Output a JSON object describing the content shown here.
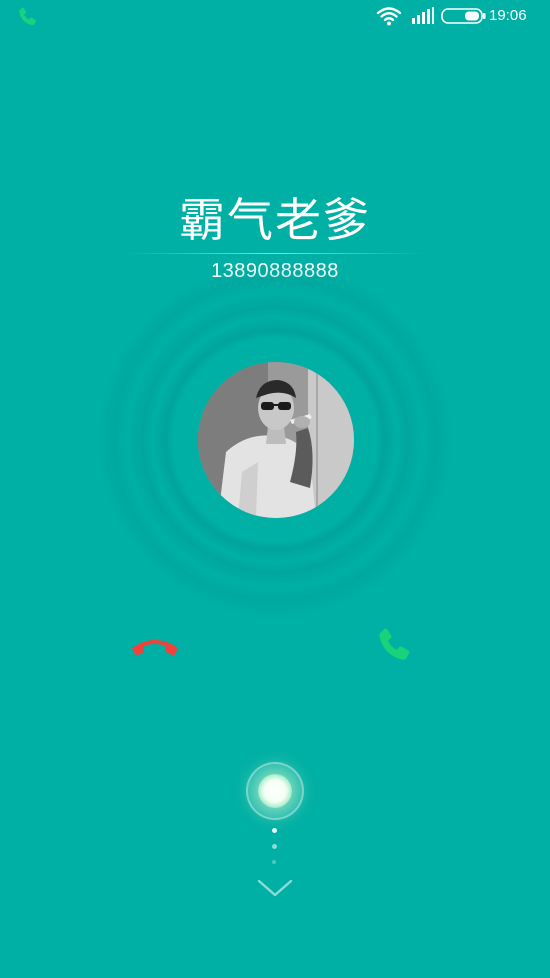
{
  "status_bar": {
    "time": "19:06",
    "icons": [
      "phone-call-icon",
      "wifi-icon",
      "signal-icon",
      "battery-icon"
    ]
  },
  "caller": {
    "name": "霸气老爹",
    "number": "13890888888"
  },
  "actions": {
    "decline_icon": "hang-up-icon",
    "answer_icon": "phone-icon",
    "decline_color": "#f0423b",
    "answer_color": "#19d27a"
  },
  "colors": {
    "background": "#00b0a4",
    "text": "#ffffff"
  }
}
